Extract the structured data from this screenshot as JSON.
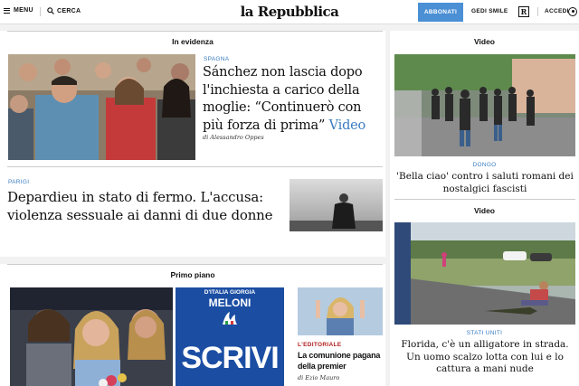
{
  "header": {
    "menu_label": "MENU",
    "search_label": "CERCA",
    "logo": "la Repubblica",
    "subscribe_label": "ABBONATI",
    "gedi_label": "GEDI SMILE",
    "r_label": "R",
    "login_label": "ACCEDI"
  },
  "in_evidenza": {
    "title": "In evidenza",
    "lead": {
      "kicker": "SPAGNA",
      "headline": "Sánchez non lascia dopo l'inchiesta a carico della moglie: “Continuerò con più forza di prima”",
      "video_label": "Video",
      "byline": "di Alessandro Oppes"
    },
    "second": {
      "kicker": "PARIGI",
      "headline": "Depardieu in stato di fermo. L'accusa: violenza sessuale ai danni di due donne"
    }
  },
  "primo_piano": {
    "title": "Primo piano",
    "poster_top": "D'ITALIA GIORGIA",
    "poster_name": "MELONI",
    "poster_word": "SCRIVI",
    "editorial": {
      "kicker": "L'EDITORIALE",
      "headline": "La comunione pagana della premier",
      "byline": "di Ezio Mauro"
    }
  },
  "sidebar": {
    "video1": {
      "section": "Video",
      "kicker": "DONGO",
      "headline": "'Bella ciao' contro i saluti romani dei nostalgici fascisti"
    },
    "video2": {
      "section": "Video",
      "kicker": "STATI UNITI",
      "headline": "Florida, c'è un alligatore in strada. Un uomo scalzo lotta con lui e lo cattura a mani nude"
    }
  },
  "colors": {
    "accent_blue": "#3a7cc1",
    "subscribe_bg": "#4b8fd4",
    "editorial_red": "#b31e1e"
  }
}
